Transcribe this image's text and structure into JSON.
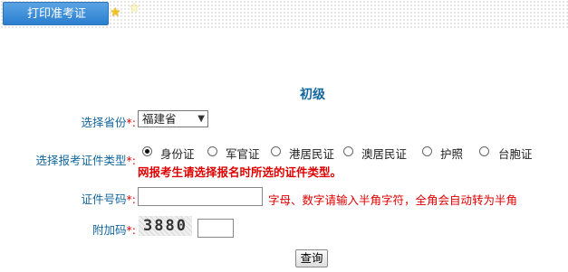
{
  "header": {
    "tab_label": "打印准考证"
  },
  "form": {
    "title": "初级",
    "province": {
      "label": "选择省份",
      "required_mark": "*:",
      "selected": "福建省"
    },
    "id_type": {
      "label": "选择报考证件类型",
      "required_mark": "*:",
      "options": [
        "身份证",
        "军官证",
        "港居民证",
        "澳居民证",
        "护照",
        "台胞证"
      ],
      "selected": "身份证",
      "warning": "网报考生请选择报名时所选的证件类型。"
    },
    "id_number": {
      "label": "证件号码",
      "required_mark": "*:",
      "value": "",
      "hint": "字母、数字请输入半角字符，全角会自动转为半角"
    },
    "captcha": {
      "label": "附加码",
      "required_mark": "*:",
      "image_text": "3880",
      "value": ""
    },
    "submit_label": "查询"
  },
  "colors": {
    "label": "#14679e",
    "required": "#e00000",
    "tab": "#2a7fd0"
  }
}
